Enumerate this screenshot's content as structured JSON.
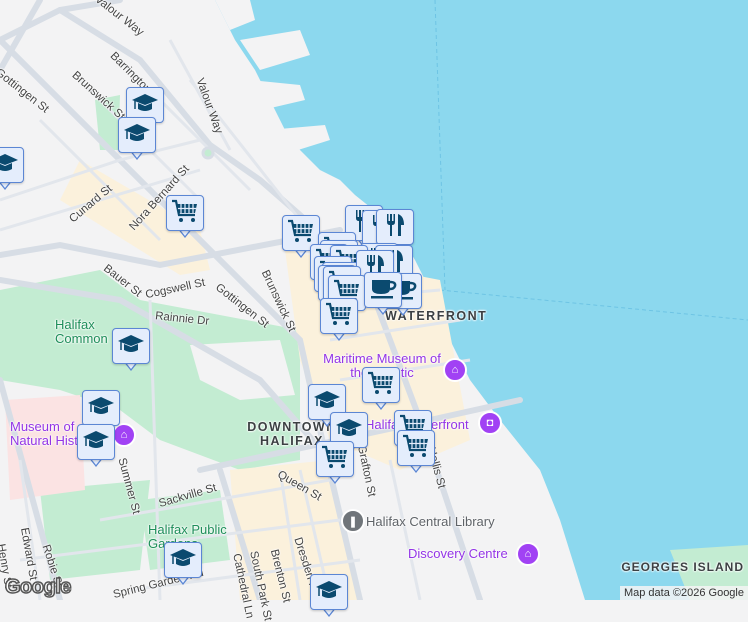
{
  "streets": {
    "valour_way_1": "Valour Way",
    "valour_way_2": "Valour Way",
    "gottingen_n": "Gottingen St",
    "barrington": "Barrington St",
    "brunswick_n": "Brunswick St",
    "cunard": "Cunard St",
    "nora_bernard": "Nora Bernard St",
    "bauer": "Bauer St",
    "cogswell": "Cogswell St",
    "gottingen_s": "Gottingen St",
    "brunswick_s": "Brunswick St",
    "rainnie": "Rainnie Dr",
    "summer": "Summer St",
    "sackville": "Sackville St",
    "queen": "Queen St",
    "robie": "Robie St",
    "edward": "Edward St",
    "henry": "Henry St",
    "spring_garden": "Spring Garden Rd",
    "brenton": "Brenton St",
    "dresden": "Dresden Row",
    "grafton": "Grafton St",
    "hollis": "Hollis St",
    "south_park": "South Park St",
    "cathedral": "Cathedral Ln"
  },
  "places": {
    "waterfront": "WATERFRONT",
    "downtown": "DOWNTOWN HALIFAX",
    "halifax_common": "Halifax Common",
    "maritime_museum": "Maritime Museum of the Atlantic",
    "museum_natural_history": "Museum of Natural History",
    "halifax_waterfront": "Halifax Waterfront",
    "central_library": "Halifax Central Library",
    "public_gardens": "Halifax Public Gardens",
    "discovery_centre": "Discovery Centre",
    "georges_island": "GEORGES ISLAND"
  },
  "footer": {
    "logo": "Google",
    "attribution": "Map data ©2026 Google"
  },
  "colors": {
    "water": "#8cd8ee",
    "land": "#f3f3f4",
    "park": "#c3ecd2",
    "commercial": "#fbf1dc",
    "marker_fill": "#e4edfc",
    "marker_border": "#5b86d4",
    "marker_icon": "#0b4a6f",
    "poi": "#a142f4"
  },
  "marker_types": [
    "graduation-cap-icon",
    "shopping-cart-icon",
    "restaurant-icon",
    "coffee-cup-icon"
  ]
}
